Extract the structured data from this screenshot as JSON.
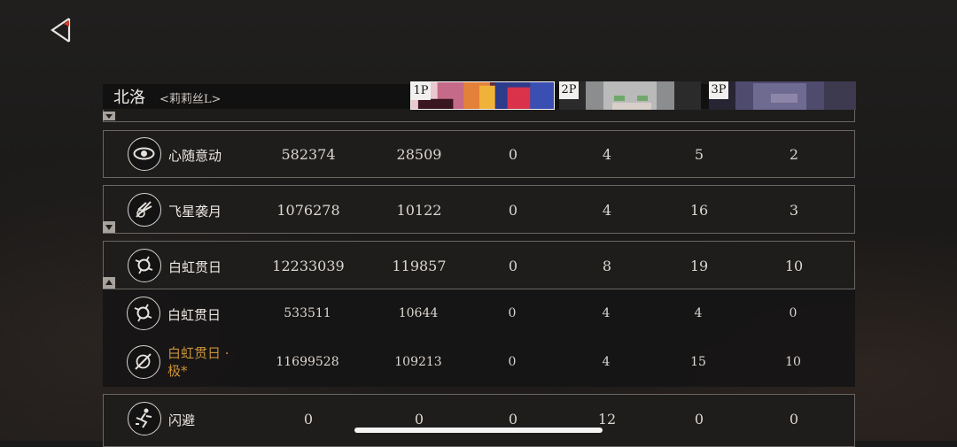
{
  "header": {
    "character_name": "北洛",
    "character_sub": "<莉莉丝L>"
  },
  "players": [
    {
      "tag": "1P"
    },
    {
      "tag": "2P"
    },
    {
      "tag": "3P"
    }
  ],
  "rows": [
    {
      "name": "心随意动",
      "icon": "eye-icon",
      "values": [
        "582374",
        "28509",
        "0",
        "4",
        "5",
        "2"
      ]
    },
    {
      "name": "飞星袭月",
      "icon": "star-slash-icon",
      "values": [
        "1076278",
        "10122",
        "0",
        "4",
        "16",
        "3"
      ]
    },
    {
      "name": "白虹贯日",
      "icon": "rainbow-sun-icon",
      "values": [
        "12233039",
        "119857",
        "0",
        "8",
        "19",
        "10"
      ]
    },
    {
      "name": "白虹贯日",
      "icon": "rainbow-sun-icon",
      "values": [
        "533511",
        "10644",
        "0",
        "4",
        "4",
        "0"
      ]
    },
    {
      "name": "白虹贯日 · 极*",
      "name_line1": "白虹贯日 ·",
      "name_line2": "极*",
      "icon": "rainbow-slash-icon",
      "values": [
        "11699528",
        "109213",
        "0",
        "4",
        "15",
        "10"
      ]
    },
    {
      "name": "闪避",
      "icon": "dodge-icon",
      "values": [
        "0",
        "0",
        "0",
        "12",
        "0",
        "0"
      ]
    }
  ]
}
